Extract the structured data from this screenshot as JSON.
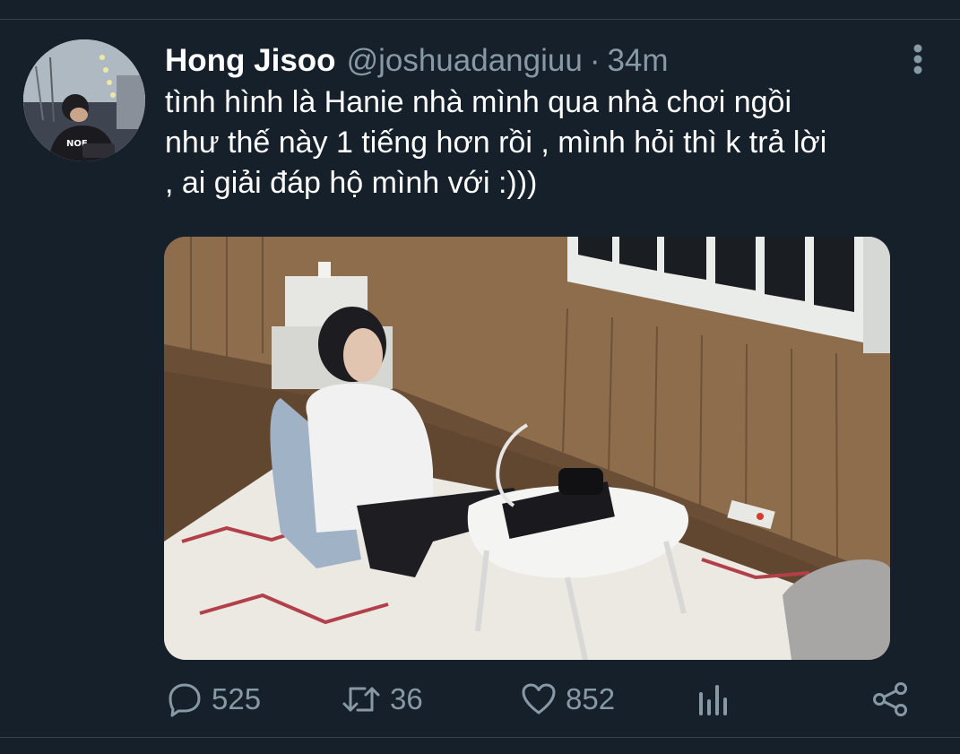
{
  "tweet": {
    "display_name": "Hong Jisoo",
    "handle": "@joshuadangiuu",
    "separator": "·",
    "time": "34m",
    "text": "tình hình là Hanie nhà mình qua nhà chơi ngồi\nnhư thế này 1 tiếng hơn rồi , mình hỏi thì k trả lời\n, ai giải đáp hộ mình với :)))",
    "avatar_shirt_text": "NOE"
  },
  "actions": {
    "replies": "525",
    "retweets": "36",
    "likes": "852"
  },
  "icons": {
    "more": "more-vertical-icon",
    "reply": "reply-icon",
    "retweet": "retweet-icon",
    "like": "heart-icon",
    "analytics": "analytics-icon",
    "share": "share-icon"
  },
  "colors": {
    "background": "#15202b",
    "primary_text": "#ffffff",
    "secondary_text": "#8899a6",
    "divider": "#38444d"
  }
}
